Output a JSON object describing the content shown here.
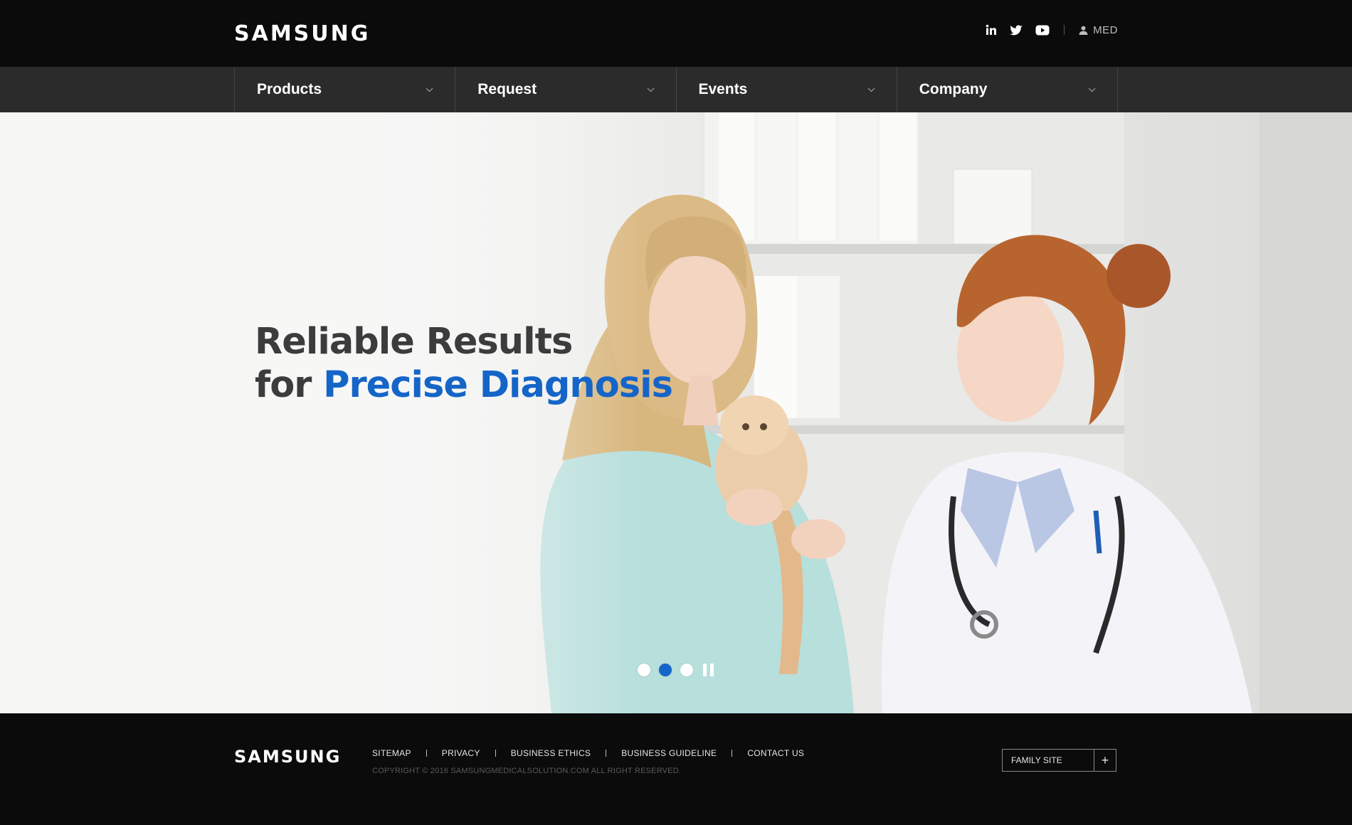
{
  "header": {
    "logo": "SAMSUNG",
    "social": [
      "linkedin-icon",
      "twitter-icon",
      "youtube-icon"
    ],
    "user_label": "MED"
  },
  "nav": {
    "items": [
      {
        "label": "Products"
      },
      {
        "label": "Request"
      },
      {
        "label": "Events"
      },
      {
        "label": "Company"
      }
    ]
  },
  "hero": {
    "headline_line1": "Reliable Results",
    "headline_line2_prefix": "for",
    "headline_line2_accent": "Precise Diagnosis",
    "accent_color": "#1565c8",
    "slides": 3,
    "active_slide": 2
  },
  "footer": {
    "logo": "SAMSUNG",
    "links": [
      "SITEMAP",
      "PRIVACY",
      "BUSINESS ETHICS",
      "BUSINESS GUIDELINE",
      "CONTACT US"
    ],
    "copyright": "COPYRIGHT © 2016 SAMSUNGMEDICALSOLUTION.COM ALL RIGHT RESERVED.",
    "family_site": "FAMILY SITE"
  }
}
